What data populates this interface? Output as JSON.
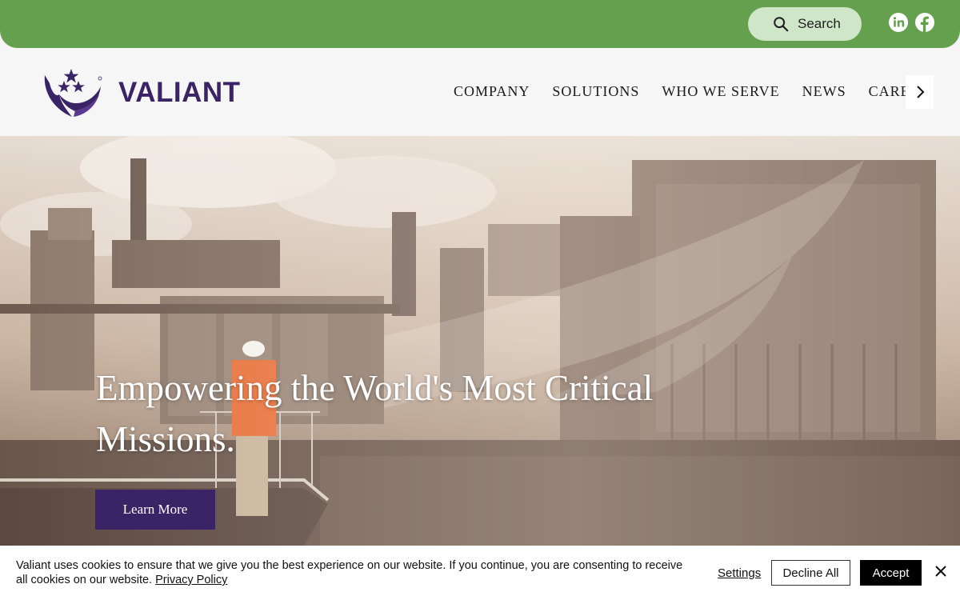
{
  "topbar": {
    "search_label": "Search",
    "icons": [
      "search-icon",
      "linkedin-icon",
      "facebook-icon"
    ],
    "bg_color": "#64a04e"
  },
  "header": {
    "logo_text": "VALIANT",
    "nav": [
      "COMPANY",
      "SOLUTIONS",
      "WHO WE SERVE",
      "NEWS",
      "CAREERS"
    ],
    "nav_more_icon": "chevron-right-icon",
    "brand_color": "#3b2466"
  },
  "hero": {
    "title": "Empowering the World's Most Critical Missions.",
    "cta_label": "Learn More"
  },
  "cookie": {
    "message": "Valiant uses cookies to ensure that we give you the best experience on our website. If you continue, you are consenting to receive all cookies on our website.",
    "privacy_link": "Privacy Policy",
    "settings_label": "Settings",
    "decline_label": "Decline All",
    "accept_label": "Accept",
    "close_icon": "close-icon"
  }
}
